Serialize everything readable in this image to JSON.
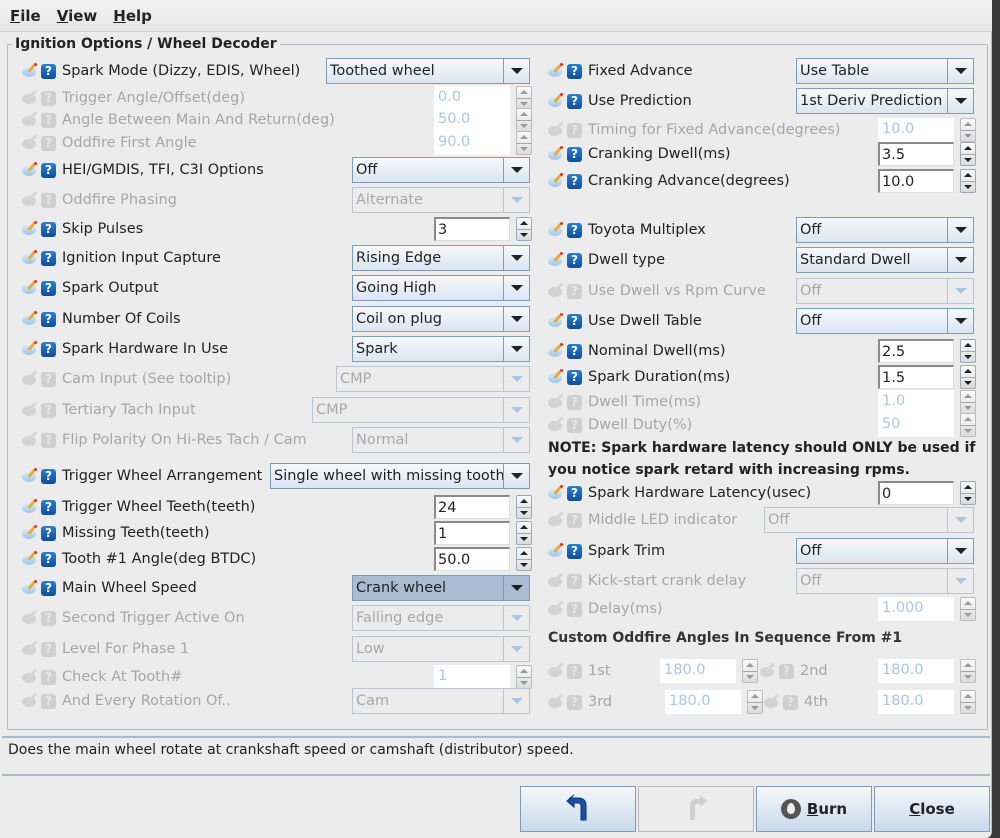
{
  "menu": [
    "File",
    "View",
    "Help"
  ],
  "group_title": "Ignition Options / Wheel Decoder",
  "left": [
    {
      "label": "Spark Mode (Dizzy, EDIS, Wheel)",
      "type": "combo",
      "value": "Toothed wheel",
      "enabled": true
    },
    {
      "label": "Trigger Angle/Offset(deg)",
      "type": "spin",
      "value": "0.0",
      "enabled": false
    },
    {
      "label": "Angle Between Main And Return(deg)",
      "type": "spin",
      "value": "50.0",
      "enabled": false
    },
    {
      "label": "Oddfire First Angle",
      "type": "spin",
      "value": "90.0",
      "enabled": false
    },
    {
      "label": "HEI/GMDIS, TFI, C3I Options",
      "type": "combo",
      "value": "Off",
      "enabled": true
    },
    {
      "label": "Oddfire Phasing",
      "type": "combo",
      "value": "Alternate",
      "enabled": false
    },
    {
      "label": "Skip Pulses",
      "type": "spin",
      "value": "3",
      "enabled": true
    },
    {
      "label": "Ignition Input Capture",
      "type": "combo",
      "value": "Rising Edge",
      "enabled": true
    },
    {
      "label": "Spark Output",
      "type": "combo",
      "value": "Going High",
      "enabled": true
    },
    {
      "label": "Number Of Coils",
      "type": "combo",
      "value": "Coil on plug",
      "enabled": true
    },
    {
      "label": "Spark Hardware In Use",
      "type": "combo",
      "value": "Spark",
      "enabled": true
    },
    {
      "label": "Cam Input (See tooltip)",
      "type": "combo",
      "value": "CMP",
      "enabled": false
    },
    {
      "label": "Tertiary Tach Input",
      "type": "combo",
      "value": "CMP",
      "enabled": false
    },
    {
      "label": "Flip Polarity On Hi-Res Tach / Cam",
      "type": "combo",
      "value": "Normal",
      "enabled": false
    },
    {
      "label": "Trigger Wheel Arrangement",
      "type": "combo",
      "value": "Single wheel with missing tooth",
      "enabled": true
    },
    {
      "label": "Trigger Wheel Teeth(teeth)",
      "type": "spin",
      "value": "24",
      "enabled": true
    },
    {
      "label": "Missing Teeth(teeth)",
      "type": "spin",
      "value": "1",
      "enabled": true
    },
    {
      "label": "Tooth #1 Angle(deg BTDC)",
      "type": "spin",
      "value": "50.0",
      "enabled": true
    },
    {
      "label": "Main Wheel Speed",
      "type": "combo",
      "value": "Crank wheel",
      "enabled": true,
      "focused": true
    },
    {
      "label": "Second Trigger Active On",
      "type": "combo",
      "value": "Falling edge",
      "enabled": false
    },
    {
      "label": "Level For Phase 1",
      "type": "combo",
      "value": "Low",
      "enabled": false
    },
    {
      "label": "Check At Tooth#",
      "type": "spin",
      "value": "1",
      "enabled": false
    },
    {
      "label": "And Every Rotation Of..",
      "type": "combo",
      "value": "Cam",
      "enabled": false
    }
  ],
  "right": [
    {
      "label": "Fixed Advance",
      "type": "combo",
      "value": "Use Table",
      "enabled": true
    },
    {
      "label": "Use Prediction",
      "type": "combo",
      "value": "1st Deriv Prediction",
      "enabled": true
    },
    {
      "label": "Timing for Fixed Advance(degrees)",
      "type": "spin",
      "value": "10.0",
      "enabled": false
    },
    {
      "label": "Cranking Dwell(ms)",
      "type": "spin",
      "value": "3.5",
      "enabled": true
    },
    {
      "label": "Cranking Advance(degrees)",
      "type": "spin",
      "value": "10.0",
      "enabled": true
    },
    {
      "label": "Toyota Multiplex",
      "type": "combo",
      "value": "Off",
      "enabled": true
    },
    {
      "label": "Dwell type",
      "type": "combo",
      "value": "Standard Dwell",
      "enabled": true
    },
    {
      "label": "Use Dwell vs Rpm Curve",
      "type": "combo",
      "value": "Off",
      "enabled": false
    },
    {
      "label": "Use Dwell Table",
      "type": "combo",
      "value": "Off",
      "enabled": true
    },
    {
      "label": "Nominal Dwell(ms)",
      "type": "spin",
      "value": "2.5",
      "enabled": true
    },
    {
      "label": "Spark Duration(ms)",
      "type": "spin",
      "value": "1.5",
      "enabled": true
    },
    {
      "label": "Dwell Time(ms)",
      "type": "spin",
      "value": "1.0",
      "enabled": false
    },
    {
      "label": "Dwell Duty(%)",
      "type": "spin",
      "value": "50",
      "enabled": false
    },
    {
      "label": "Spark Hardware Latency(usec)",
      "type": "spin",
      "value": "0",
      "enabled": true
    },
    {
      "label": "Middle LED indicator",
      "type": "combo",
      "value": "Off",
      "enabled": false
    },
    {
      "label": "Spark Trim",
      "type": "combo",
      "value": "Off",
      "enabled": true
    },
    {
      "label": "Kick-start crank delay",
      "type": "combo",
      "value": "Off",
      "enabled": false
    },
    {
      "label": "Delay(ms)",
      "type": "spin",
      "value": "1.000",
      "enabled": false
    }
  ],
  "note": "NOTE: Spark hardware latency should ONLY be used if you notice spark retard with increasing rpms.",
  "oddfire": {
    "heading": "Custom Oddfire Angles In Sequence From #1",
    "items": [
      {
        "label": "1st",
        "value": "180.0"
      },
      {
        "label": "2nd",
        "value": "180.0"
      },
      {
        "label": "3rd",
        "value": "180.0"
      },
      {
        "label": "4th",
        "value": "180.0"
      }
    ]
  },
  "help_text": "Does the main wheel rotate at crankshaft speed or camshaft (distributor) speed.",
  "buttons": {
    "undo": "undo-icon",
    "redo": "redo-icon",
    "burn": "Burn",
    "close": "Close"
  }
}
